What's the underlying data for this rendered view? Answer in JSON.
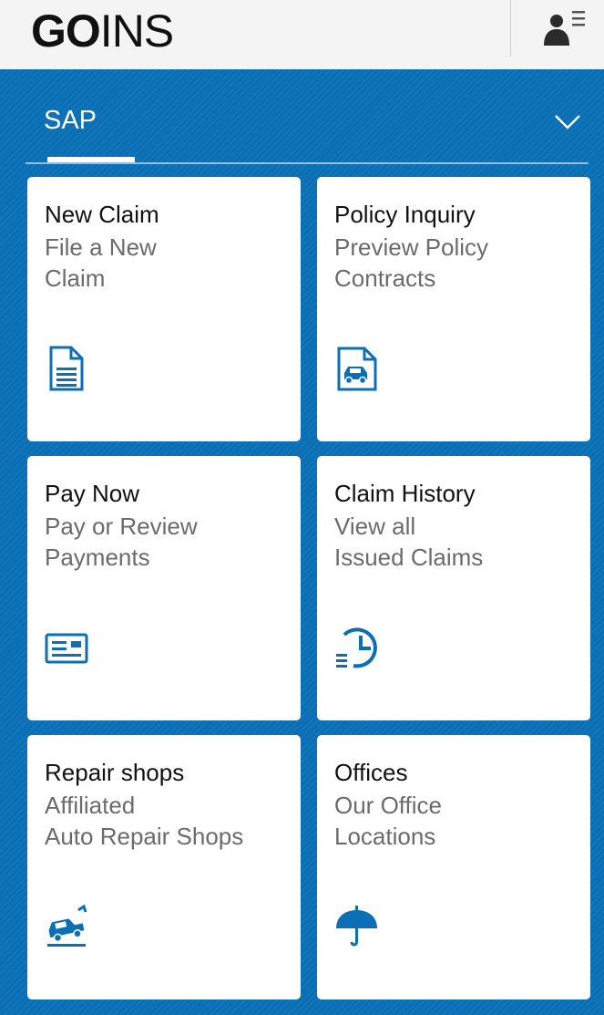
{
  "header": {
    "logo_bold": "GO",
    "logo_regular": "INS"
  },
  "tabbar": {
    "label": "SAP"
  },
  "colors": {
    "accent": "#0a6fb5",
    "tile_bg": "#ffffff",
    "title_text": "#111111",
    "subtitle_text": "#6b6b6b"
  },
  "tiles": [
    {
      "title": "New Claim",
      "sub1": "File a New",
      "sub2": "Claim",
      "icon": "document-icon"
    },
    {
      "title": "Policy Inquiry",
      "sub1": "Preview Policy",
      "sub2": "Contracts",
      "icon": "car-document-icon"
    },
    {
      "title": "Pay Now",
      "sub1": "Pay or Review",
      "sub2": "Payments",
      "icon": "payment-card-icon"
    },
    {
      "title": "Claim History",
      "sub1": "View all",
      "sub2": "Issued Claims",
      "icon": "history-clock-icon"
    },
    {
      "title": "Repair shops",
      "sub1": "Affiliated",
      "sub2": "Auto Repair Shops",
      "icon": "tow-truck-icon"
    },
    {
      "title": "Offices",
      "sub1": "Our Office",
      "sub2": "Locations",
      "icon": "umbrella-icon"
    }
  ]
}
